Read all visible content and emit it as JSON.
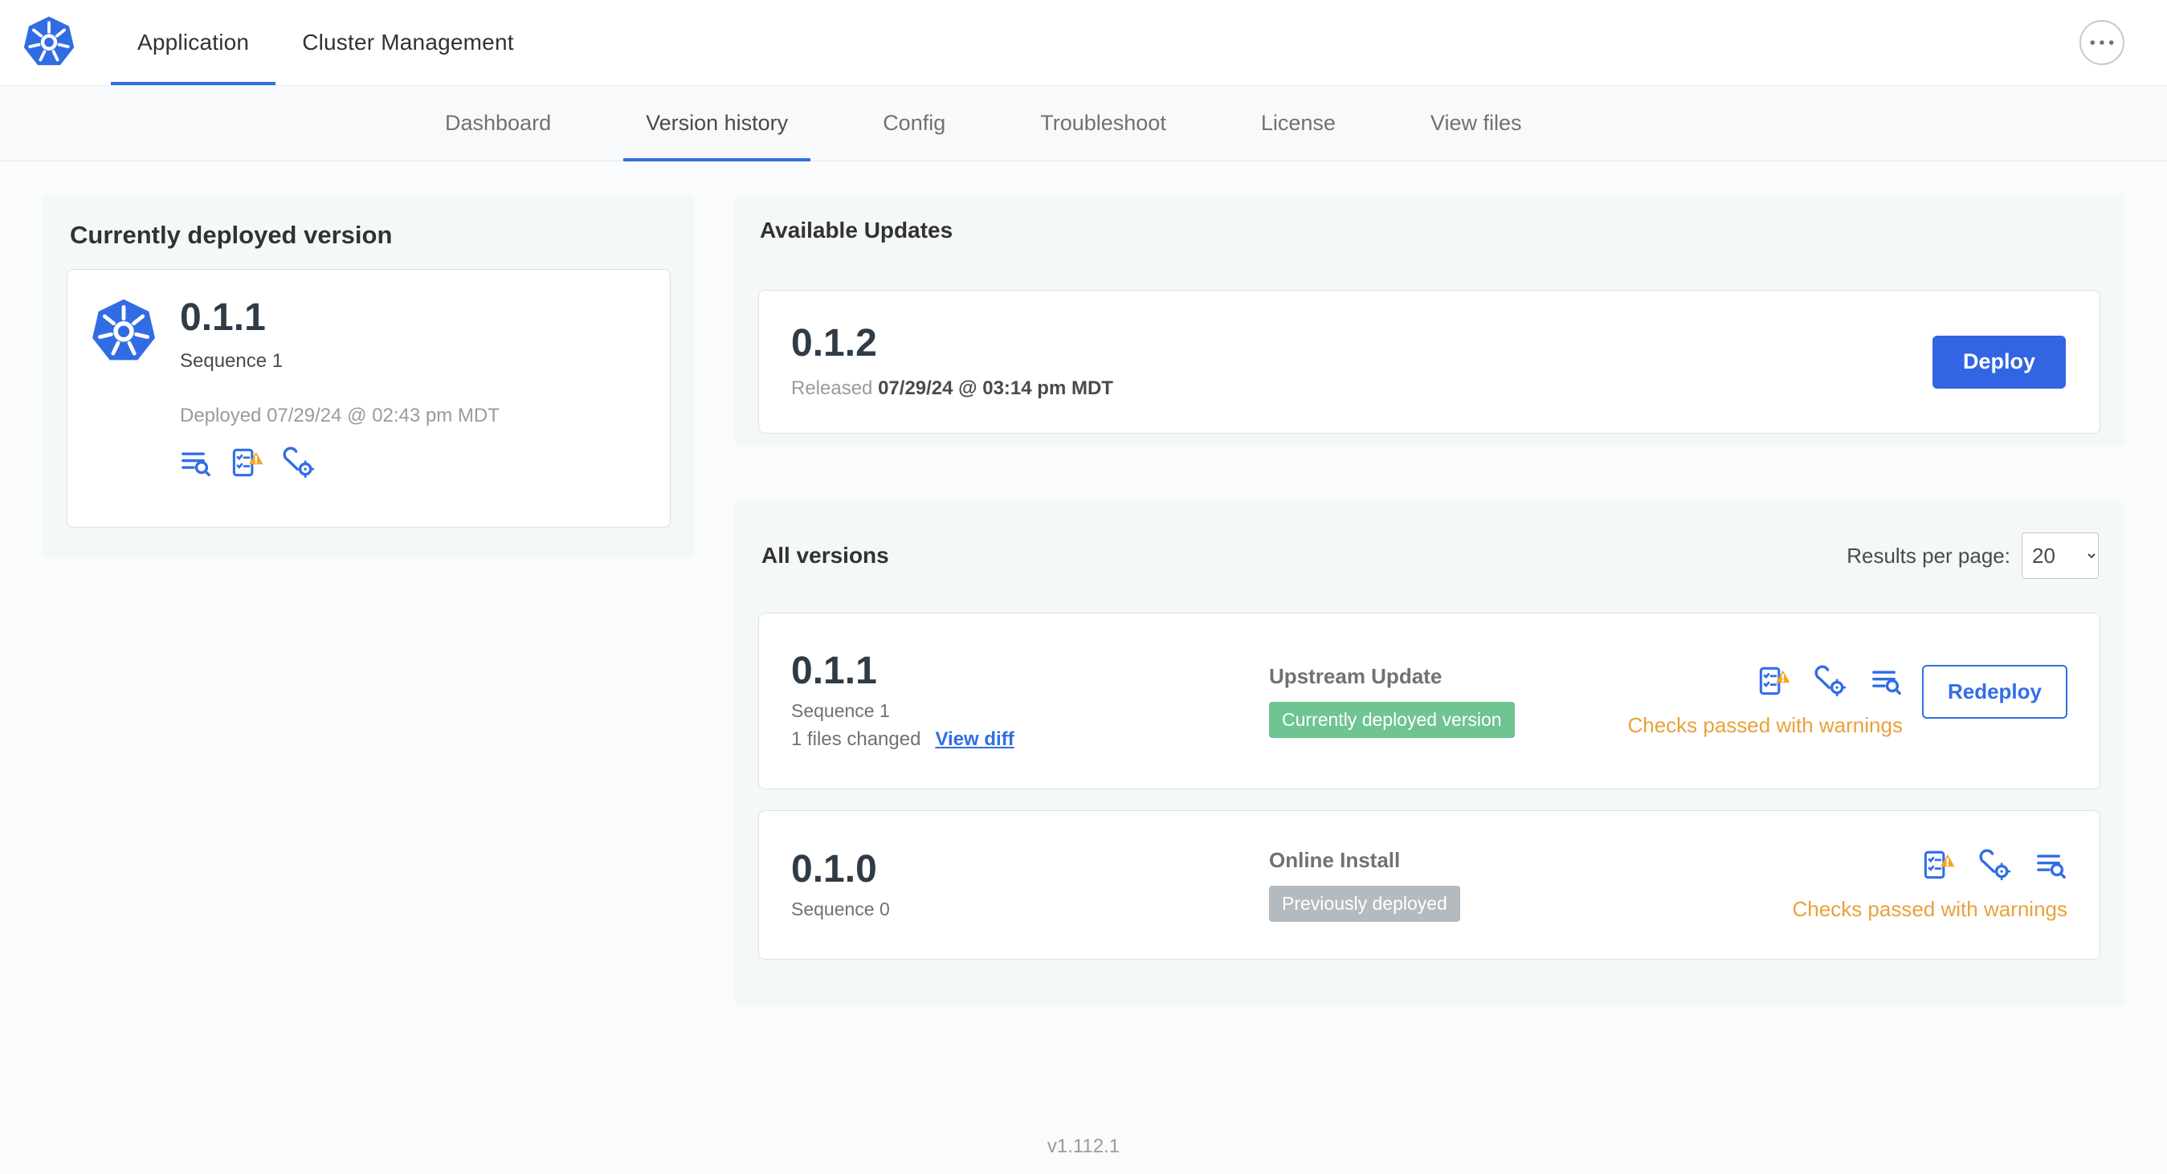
{
  "header": {
    "tabs": [
      {
        "label": "Application"
      },
      {
        "label": "Cluster Management"
      }
    ]
  },
  "nav": {
    "items": [
      "Dashboard",
      "Version history",
      "Config",
      "Troubleshoot",
      "License",
      "View files"
    ],
    "active": "Version history"
  },
  "current_version": {
    "title": "Currently deployed version",
    "version": "0.1.1",
    "sequence": "Sequence 1",
    "deployed": "Deployed 07/29/24 @ 02:43 pm MDT"
  },
  "available_updates": {
    "title": "Available Updates",
    "version": "0.1.2",
    "released_label": "Released",
    "released_date": "07/29/24 @ 03:14 pm MDT",
    "deploy_button": "Deploy"
  },
  "all_versions": {
    "title": "All versions",
    "results_per_page_label": "Results per page:",
    "results_per_page_value": "20",
    "rows": [
      {
        "version": "0.1.1",
        "sequence": "Sequence 1",
        "files_changed": "1 files changed",
        "view_diff_label": "View diff",
        "source": "Upstream Update",
        "badge": "Currently deployed version",
        "action_button": "Redeploy",
        "status": "Checks passed with warnings"
      },
      {
        "version": "0.1.0",
        "sequence": "Sequence 0",
        "source": "Online Install",
        "badge": "Previously deployed",
        "status": "Checks passed with warnings"
      }
    ]
  },
  "footer": {
    "app_version": "v1.112.1"
  },
  "icons": {
    "logo": "kubernetes-wheel",
    "more_menu": "ellipsis",
    "release_notes": "text-lines-magnifier",
    "preflight_checks": "checklist-warning",
    "edit_config": "wrench-gear"
  },
  "colors": {
    "accent_blue": "#326DE6",
    "deploy_button_blue": "#3365E3",
    "deployed_badge_green": "#6FC492",
    "previous_badge_gray": "#B3BAC0",
    "warning_orange": "#E9A13B"
  }
}
